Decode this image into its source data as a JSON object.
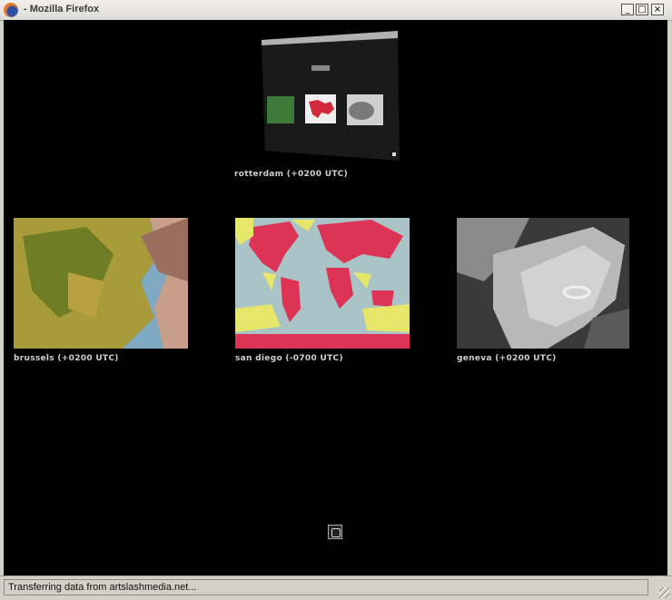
{
  "window": {
    "title": "- Mozilla Firefox"
  },
  "window_buttons": {
    "minimize": "_",
    "maximize": "□",
    "close": "×"
  },
  "cameras": [
    {
      "id": "rotterdam",
      "label": "rotterdam (+0200 UTC)"
    },
    {
      "id": "brussels",
      "label": "brussels (+0200 UTC)"
    },
    {
      "id": "san-diego",
      "label": "san diego (-0700 UTC)"
    },
    {
      "id": "geneva",
      "label": "geneva (+0200 UTC)"
    }
  ],
  "status": {
    "text": "Transferring data from artslashmedia.net..."
  }
}
